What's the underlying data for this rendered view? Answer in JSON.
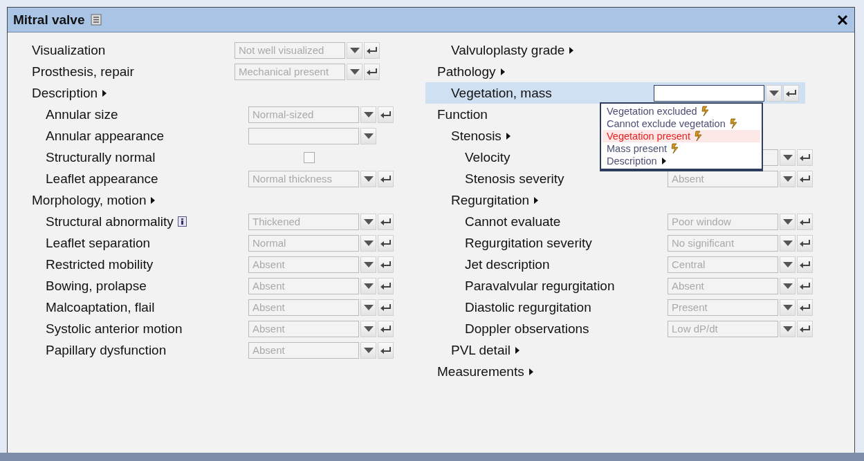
{
  "dialog": {
    "title": "Mitral valve",
    "left": [
      {
        "kind": "select",
        "label": "Visualization",
        "value": "Not well visualized",
        "enter": true
      },
      {
        "kind": "select",
        "label": "Prosthesis, repair",
        "value": "Mechanical present",
        "enter": true
      },
      {
        "kind": "section",
        "label": "Description",
        "children": [
          {
            "kind": "select",
            "label": "Annular size",
            "value": "Normal-sized",
            "enter": true
          },
          {
            "kind": "select",
            "label": "Annular appearance",
            "enter": false
          },
          {
            "kind": "checkbox",
            "label": "Structurally normal",
            "checked": false
          },
          {
            "kind": "select",
            "label": "Leaflet appearance",
            "value": "Normal thickness",
            "enter": true
          }
        ]
      },
      {
        "kind": "section",
        "label": "Morphology, motion",
        "children": [
          {
            "kind": "select",
            "label": "Structural abnormality",
            "info": true,
            "value": "Thickened",
            "enter": true
          },
          {
            "kind": "select",
            "label": "Leaflet separation",
            "value": "Normal",
            "enter": true
          },
          {
            "kind": "select",
            "label": "Restricted mobility",
            "value": "Absent",
            "enter": true
          },
          {
            "kind": "select",
            "label": "Bowing, prolapse",
            "value": "Absent",
            "enter": true
          },
          {
            "kind": "select",
            "label": "Malcoaptation, flail",
            "value": "Absent",
            "enter": true
          },
          {
            "kind": "select",
            "label": "Systolic anterior motion",
            "value": "Absent",
            "enter": true
          },
          {
            "kind": "select",
            "label": "Papillary dysfunction",
            "value": "Absent",
            "enter": true
          }
        ]
      }
    ],
    "right": [
      {
        "kind": "group",
        "children": [
          {
            "kind": "section",
            "label": "Valvuloplasty grade"
          }
        ]
      },
      {
        "kind": "section",
        "label": "Pathology",
        "children": [
          {
            "kind": "select",
            "label": "Vegetation, mass",
            "selected": true,
            "focused": true,
            "enter": true,
            "options": [
              {
                "kind": "finding",
                "label": "Vegetation excluded",
                "selected": false
              },
              {
                "kind": "finding",
                "label": "Cannot exclude vegetation",
                "selected": false
              },
              {
                "kind": "finding",
                "label": "Vegetation present",
                "selected": true
              },
              {
                "kind": "finding",
                "label": "Mass present",
                "selected": false
              },
              {
                "kind": "submenu",
                "label": "Description",
                "selected": false
              }
            ]
          }
        ]
      },
      {
        "kind": "heading",
        "label": "Function",
        "children": [
          {
            "kind": "section",
            "label": "Stenosis",
            "children": [
              {
                "kind": "select",
                "label": "Velocity",
                "enter": true
              },
              {
                "kind": "select",
                "label": "Stenosis severity",
                "value": "Absent",
                "enter": true
              }
            ]
          },
          {
            "kind": "section",
            "label": "Regurgitation",
            "children": [
              {
                "kind": "select",
                "label": "Cannot evaluate",
                "value": "Poor window",
                "enter": true
              },
              {
                "kind": "select",
                "label": "Regurgitation severity",
                "value": "No significant",
                "enter": true
              },
              {
                "kind": "select",
                "label": "Jet description",
                "value": "Central",
                "enter": true
              },
              {
                "kind": "select",
                "label": "Paravalvular regurgitation",
                "value": "Absent",
                "enter": true
              },
              {
                "kind": "select",
                "label": "Diastolic regurgitation",
                "value": "Present",
                "enter": true
              },
              {
                "kind": "select",
                "label": "Doppler observations",
                "value": "Low dP/dt",
                "enter": true
              }
            ]
          },
          {
            "kind": "section",
            "label": "PVL detail"
          }
        ]
      },
      {
        "kind": "section",
        "label": "Measurements"
      }
    ]
  }
}
